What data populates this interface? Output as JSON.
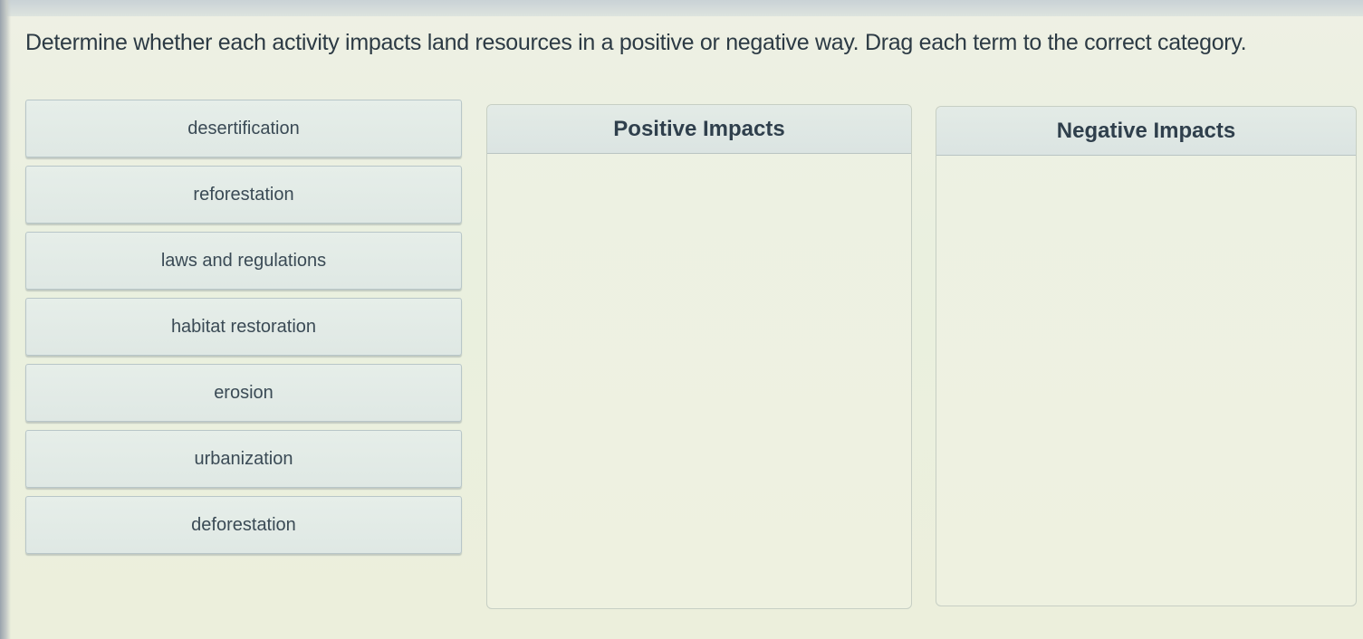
{
  "instructions": "Determine whether each activity impacts land resources in a positive or negative way. Drag each term to the correct category.",
  "terms": [
    "desertification",
    "reforestation",
    "laws and regulations",
    "habitat restoration",
    "erosion",
    "urbanization",
    "deforestation"
  ],
  "categories": {
    "positive": {
      "title": "Positive Impacts",
      "items": []
    },
    "negative": {
      "title": "Negative Impacts",
      "items": []
    }
  }
}
